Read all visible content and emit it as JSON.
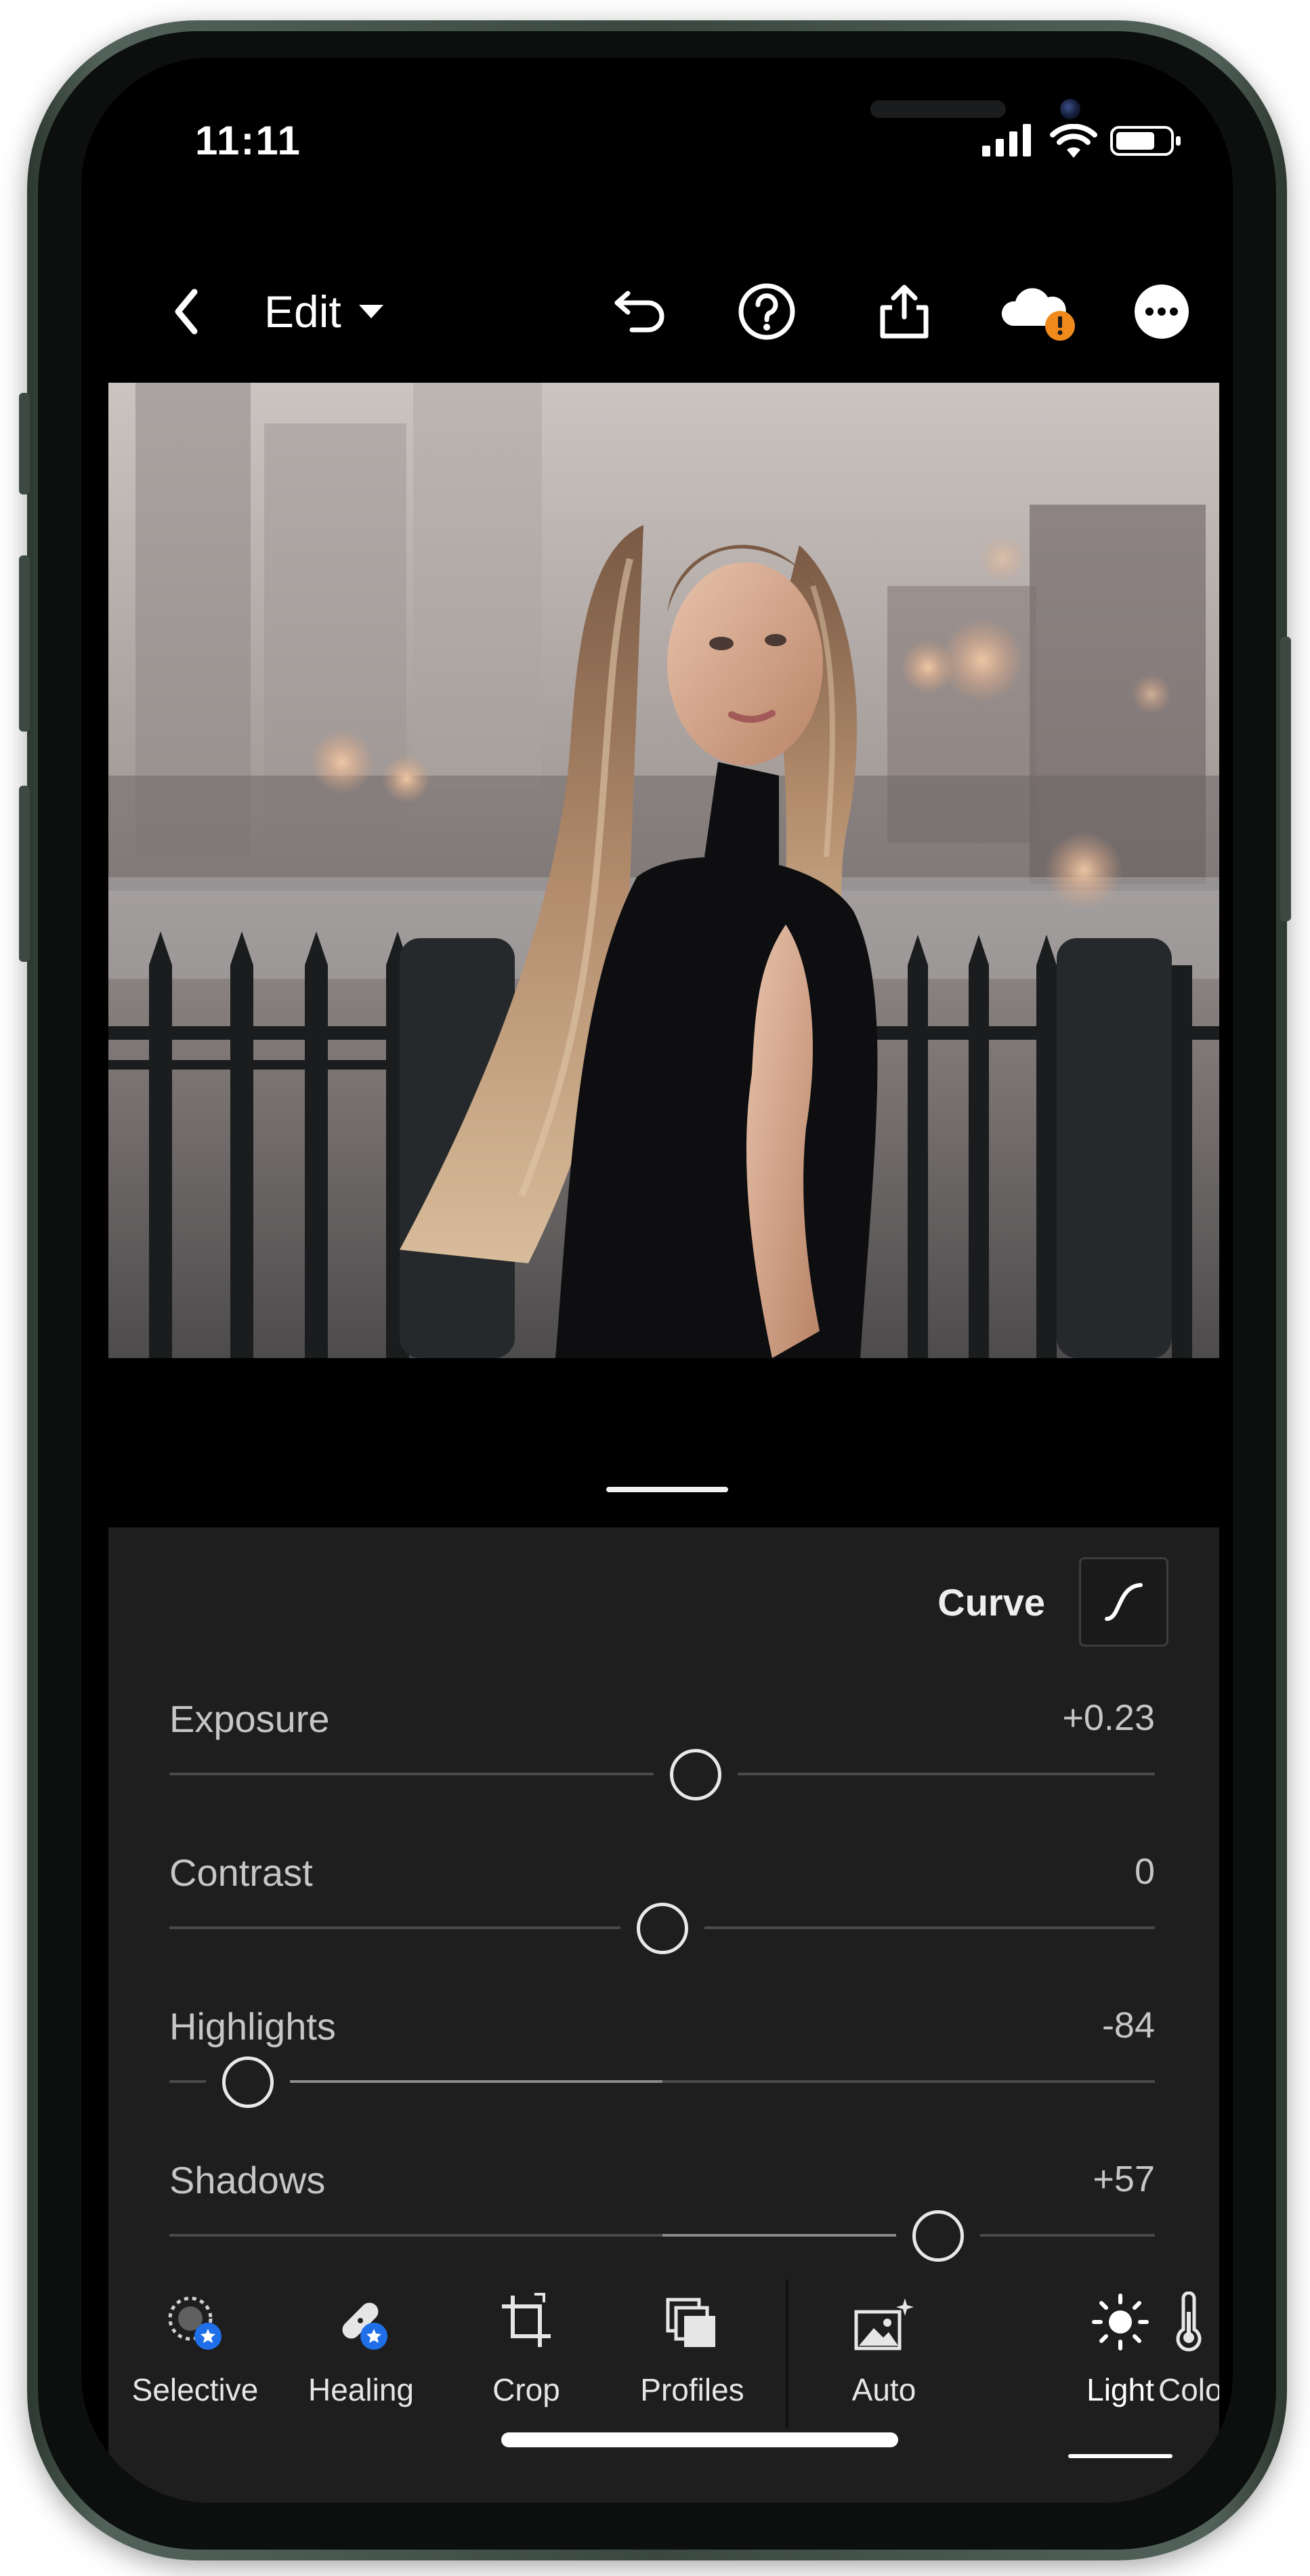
{
  "status_bar": {
    "time": "11:11"
  },
  "toolbar": {
    "back_icon": "chevron-left-icon",
    "edit_label": "Edit",
    "edit_dropdown_icon": "caret-down-icon",
    "undo_icon": "undo-icon",
    "help_icon": "help-icon",
    "share_icon": "share-icon",
    "cloud_icon": "cloud-warning-icon",
    "more_icon": "more-icon"
  },
  "panel": {
    "curve_label": "Curve",
    "sliders": [
      {
        "label": "Exposure",
        "value": "+0.23",
        "position": 0.534
      },
      {
        "label": "Contrast",
        "value": "0",
        "position": 0.5
      },
      {
        "label": "Highlights",
        "value": "-84",
        "position": 0.08
      },
      {
        "label": "Shadows",
        "value": "+57",
        "position": 0.78
      }
    ]
  },
  "bottom_nav": {
    "items": [
      {
        "label": "Selective",
        "icon": "selective-icon"
      },
      {
        "label": "Healing",
        "icon": "healing-icon"
      },
      {
        "label": "Crop",
        "icon": "crop-icon"
      },
      {
        "label": "Profiles",
        "icon": "profiles-icon"
      },
      {
        "label": "Auto",
        "icon": "auto-icon"
      },
      {
        "label": "Light",
        "icon": "light-icon",
        "active": true
      },
      {
        "label": "Color",
        "icon": "thermometer-icon"
      }
    ]
  },
  "colors": {
    "accent_orange": "#f08a1c",
    "badge_blue": "#1f6fe8",
    "panel_bg": "#1e1e1e",
    "device_frame": "#3a4840"
  }
}
